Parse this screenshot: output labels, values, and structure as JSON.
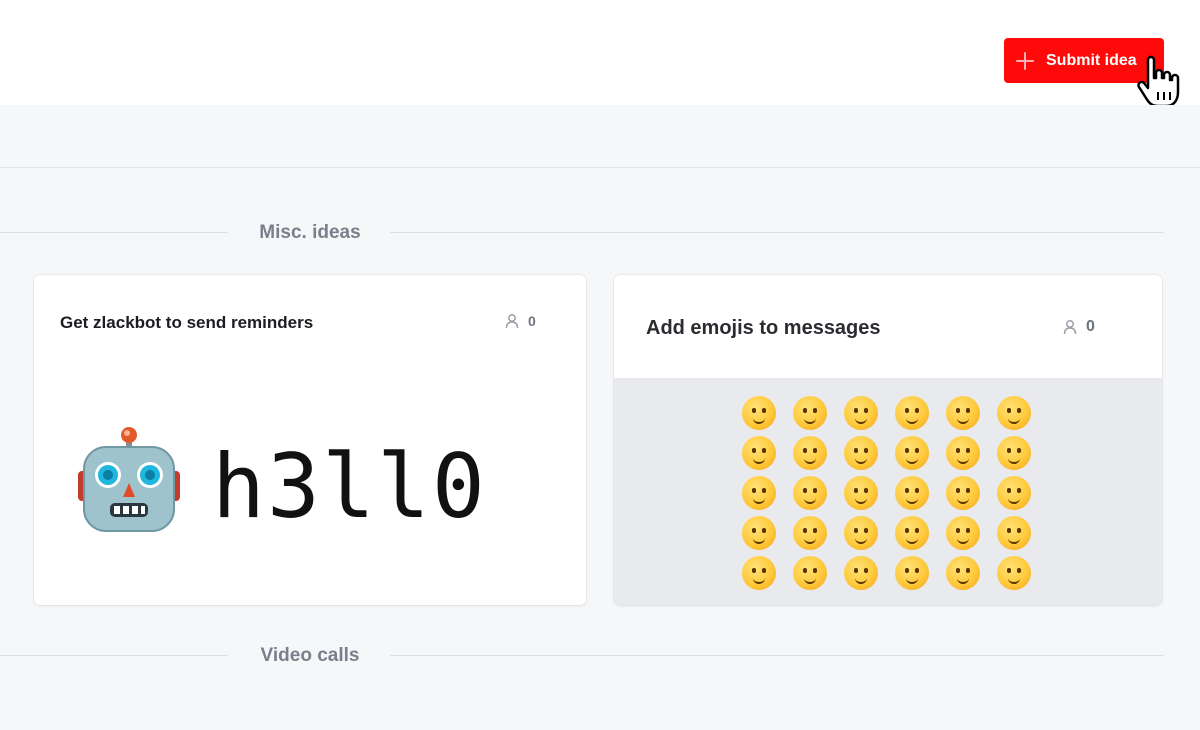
{
  "header": {
    "submit_button_label": "Submit idea",
    "accent_color": "#ff0a0a"
  },
  "sections": [
    {
      "title": "Misc. ideas"
    },
    {
      "title": "Video calls"
    }
  ],
  "cards": [
    {
      "title": "Get zlackbot to send reminders",
      "voter_count": "0",
      "image_text": "h3ll0",
      "image_icon": "robot-icon"
    },
    {
      "title": "Add emojis to messages",
      "voter_count": "0",
      "image_icon": "emoji-grid",
      "emoji_count": 30
    }
  ],
  "icons": {
    "submit": "plus-icon",
    "cursor": "hand-pointer-icon",
    "voters": "person-icon"
  }
}
